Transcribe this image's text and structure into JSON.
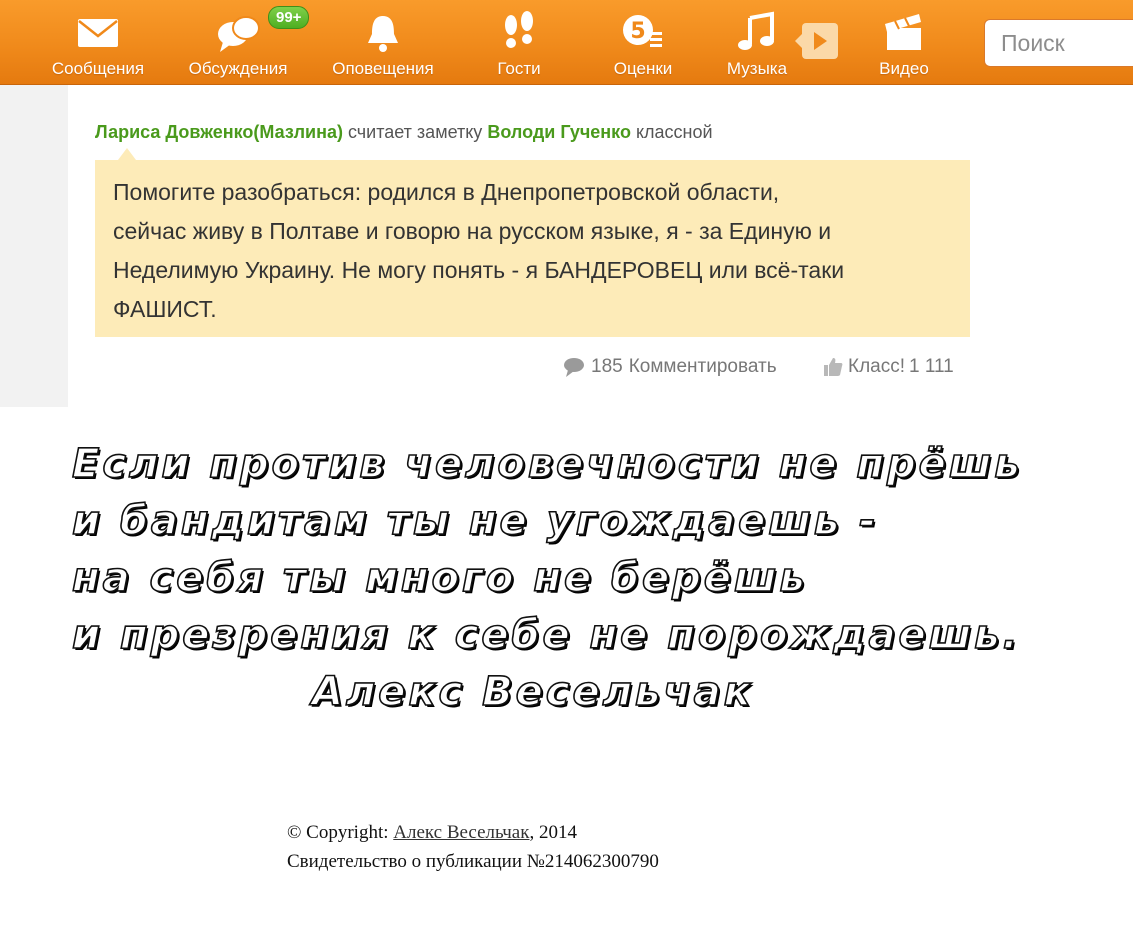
{
  "nav": {
    "items": [
      {
        "label": "Сообщения",
        "icon": "envelope-icon"
      },
      {
        "label": "Обсуждения",
        "icon": "chat-bubbles-icon"
      },
      {
        "label": "Оповещения",
        "icon": "bell-icon"
      },
      {
        "label": "Гости",
        "icon": "footprints-icon"
      },
      {
        "label": "Оценки",
        "icon": "rating-five-icon"
      },
      {
        "label": "Музыка",
        "icon": "music-note-icon"
      },
      {
        "label": "Видео",
        "icon": "clapperboard-icon"
      }
    ],
    "discussions_badge": "99+",
    "search_placeholder": "Поиск"
  },
  "feed": {
    "author": "Лариса Довженко(Мазлина)",
    "action_text": "считает заметку",
    "note_owner": "Володи Гученко",
    "suffix": "классной",
    "note_lines": [
      "Помогите разобраться: родился в Днепропетровской области,",
      "сейчас живу в Полтаве и говорю на русском языке, я - за Единую и",
      "Неделимую Украину. Не могу понять -  я БАНДЕРОВЕЦ или всё-таки",
      "ФАШИСТ."
    ],
    "comments_count": "185",
    "comment_label": "Комментировать",
    "like_label": "Класс!",
    "like_count": "1 111"
  },
  "poem": {
    "lines": [
      "Если против человечности не прёшь",
      "и бандитам ты не угождаешь -",
      "на себя ты много не берёшь",
      "и презрения к себе не порождаешь."
    ],
    "author": "Алекс Весельчак"
  },
  "copyright": {
    "prefix": "© Copyright:",
    "author_link": "Алекс Весельчак",
    "year": ", 2014",
    "certificate": "Свидетельство о публикации №214062300790"
  },
  "colors": {
    "topbar": "#f08a1b",
    "user_link": "#4a9a1c",
    "note_bg": "#fdebb8",
    "badge": "#4fae21"
  }
}
